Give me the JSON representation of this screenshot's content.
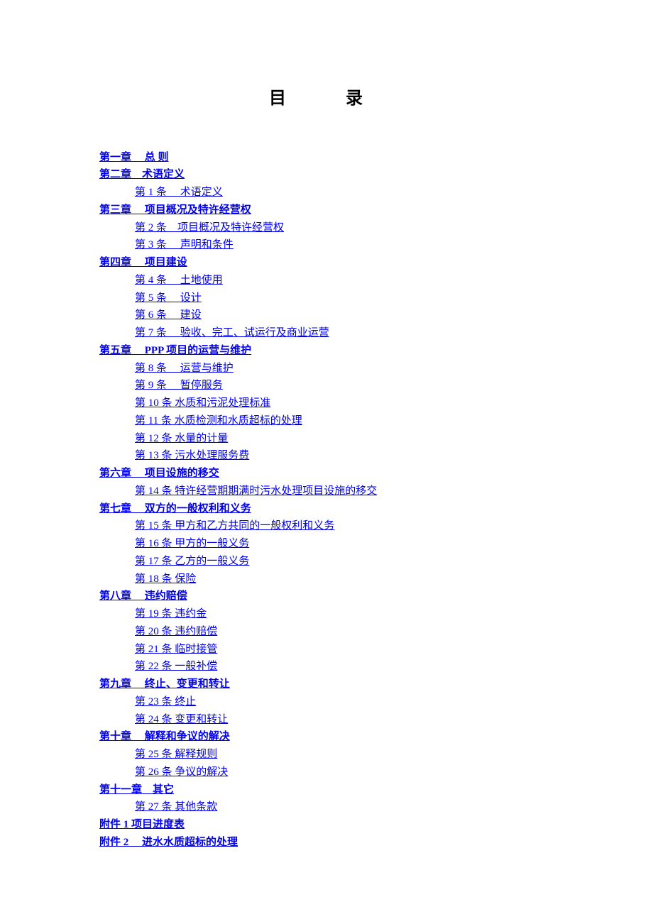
{
  "title": "目　录",
  "toc": [
    {
      "type": "chapter",
      "text": "第一章　 总 则"
    },
    {
      "type": "chapter",
      "text": "第二章　术语定义"
    },
    {
      "type": "article",
      "text": "第 1 条　 术语定义"
    },
    {
      "type": "chapter",
      "text": "第三章　 项目概况及特许经营权"
    },
    {
      "type": "article",
      "text": "第 2 条　项目概况及特许经营权"
    },
    {
      "type": "article",
      "text": "第 3 条　 声明和条件"
    },
    {
      "type": "chapter",
      "text": "第四章　 项目建设"
    },
    {
      "type": "article",
      "text": "第 4 条　 土地使用"
    },
    {
      "type": "article",
      "text": "第 5 条　 设计"
    },
    {
      "type": "article",
      "text": "第 6 条　 建设"
    },
    {
      "type": "article",
      "text": "第 7 条　 验收、完工、试运行及商业运营"
    },
    {
      "type": "chapter",
      "text": "第五章　 PPP 项目的运营与维护"
    },
    {
      "type": "article",
      "text": "第 8 条　 运营与维护"
    },
    {
      "type": "article",
      "text": "第 9 条　 暂停服务"
    },
    {
      "type": "article",
      "text": "第 10 条  水质和污泥处理标准"
    },
    {
      "type": "article",
      "text": "第 11 条  水质检测和水质超标的处理"
    },
    {
      "type": "article",
      "text": "第 12 条  水量的计量"
    },
    {
      "type": "article",
      "text": "第 13 条  污水处理服务费"
    },
    {
      "type": "chapter",
      "text": "第六章　 项目设施的移交"
    },
    {
      "type": "article",
      "text": "第 14 条  特许经营期期满时污水处理项目设施的移交"
    },
    {
      "type": "chapter",
      "text": "第七章　 双方的一般权利和义务"
    },
    {
      "type": "article",
      "text": "第 15 条  甲方和乙方共同的一般权利和义务"
    },
    {
      "type": "article",
      "text": "第 16 条  甲方的一般义务"
    },
    {
      "type": "article",
      "text": "第 17 条  乙方的一般义务"
    },
    {
      "type": "article",
      "text": "第 18 条  保险"
    },
    {
      "type": "chapter",
      "text": "第八章　 违约赔偿"
    },
    {
      "type": "article",
      "text": "第 19 条  违约金"
    },
    {
      "type": "article",
      "text": "第 20 条  违约赔偿"
    },
    {
      "type": "article",
      "text": "第 21 条  临时接管"
    },
    {
      "type": "article",
      "text": "第 22 条  一般补偿"
    },
    {
      "type": "chapter",
      "text": "第九章　 终止、变更和转让"
    },
    {
      "type": "article",
      "text": "第 23 条  终止"
    },
    {
      "type": "article",
      "text": "第 24 条  变更和转让"
    },
    {
      "type": "chapter",
      "text": "第十章　 解释和争议的解决"
    },
    {
      "type": "article",
      "text": "第 25 条  解释规则"
    },
    {
      "type": "article",
      "text": "第 26 条  争议的解决"
    },
    {
      "type": "chapter",
      "text": "第十一章　其它"
    },
    {
      "type": "article",
      "text": "第 27 条  其他条款"
    },
    {
      "type": "chapter",
      "text": "附件 1   项目进度表"
    },
    {
      "type": "chapter",
      "text": "附件 2　 进水水质超标的处理"
    }
  ]
}
